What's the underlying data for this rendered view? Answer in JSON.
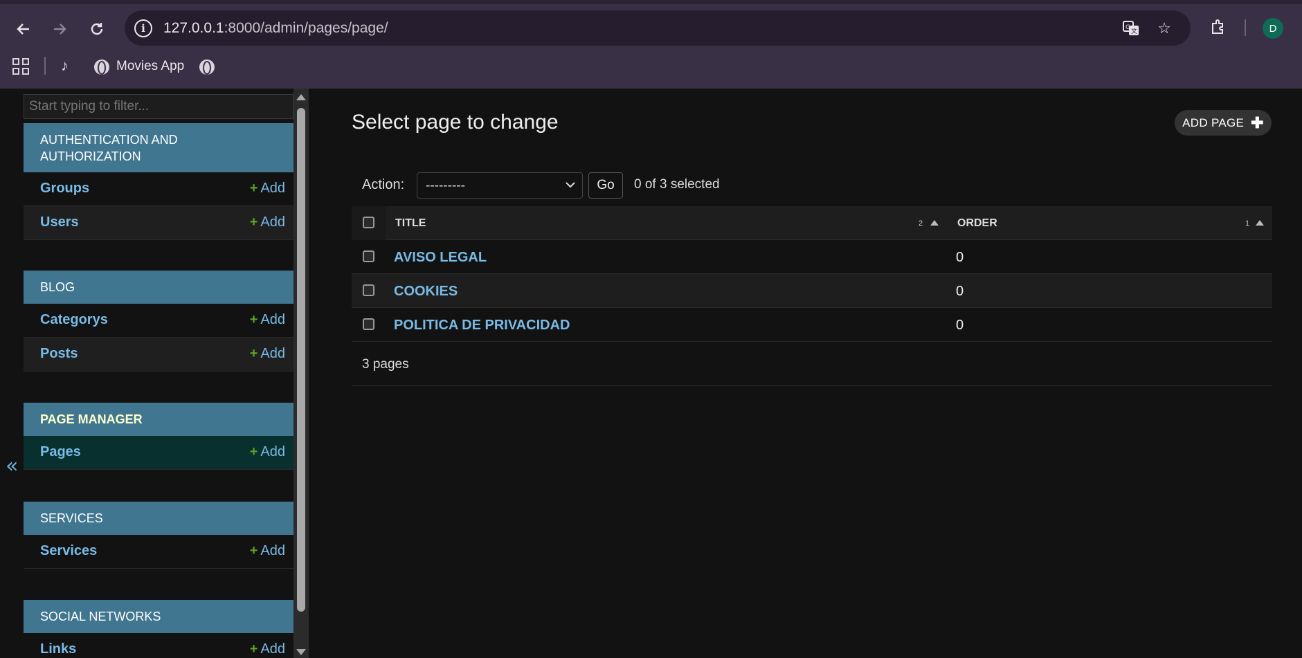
{
  "browser": {
    "url_host": "127.0.0.1",
    "url_rest": ":8000/admin/pages/page/",
    "profile_initial": "D",
    "bookmarks": [
      {
        "label": ""
      },
      {
        "label": "Movies App"
      },
      {
        "label": ""
      }
    ]
  },
  "sidebar": {
    "filter_placeholder": "Start typing to filter...",
    "modules": [
      {
        "caption": "AUTHENTICATION AND AUTHORIZATION",
        "models": [
          {
            "name": "Groups",
            "add": "Add"
          },
          {
            "name": "Users",
            "add": "Add"
          }
        ]
      },
      {
        "caption": "BLOG",
        "models": [
          {
            "name": "Categorys",
            "add": "Add"
          },
          {
            "name": "Posts",
            "add": "Add"
          }
        ]
      },
      {
        "caption": "PAGE MANAGER",
        "models": [
          {
            "name": "Pages",
            "add": "Add"
          }
        ]
      },
      {
        "caption": "SERVICES",
        "models": [
          {
            "name": "Services",
            "add": "Add"
          }
        ]
      },
      {
        "caption": "SOCIAL NETWORKS",
        "models": [
          {
            "name": "Links",
            "add": "Add"
          }
        ]
      }
    ],
    "toggle_label": "«"
  },
  "content": {
    "title": "Select page to change",
    "add_button": "ADD PAGE",
    "action_label": "Action:",
    "action_selected": "---------",
    "go_label": "Go",
    "counter": "0 of 3 selected",
    "columns": [
      {
        "label": "TITLE",
        "sort_priority": "2"
      },
      {
        "label": "ORDER",
        "sort_priority": "1"
      }
    ],
    "rows": [
      {
        "title": "AVISO LEGAL",
        "order": "0"
      },
      {
        "title": "COOKIES",
        "order": "0"
      },
      {
        "title": "POLITICA DE PRIVACIDAD",
        "order": "0"
      }
    ],
    "paginator": "3 pages"
  },
  "colors": {
    "module_caption_bg": "#417690",
    "link": "#79bbe6",
    "add_plus": "#5fa225",
    "current_row": "#07302f",
    "current_caption_text": "#ffffcc"
  }
}
